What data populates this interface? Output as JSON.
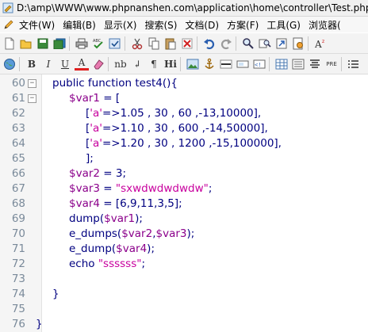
{
  "window": {
    "title": "D:\\amp\\WWW\\www.phpnanshen.com\\application\\home\\controller\\Test.php"
  },
  "menu": {
    "items": [
      {
        "id": "file",
        "label": "文件(W)"
      },
      {
        "id": "edit",
        "label": "编辑(B)"
      },
      {
        "id": "view",
        "label": "显示(X)"
      },
      {
        "id": "search",
        "label": "搜索(S)"
      },
      {
        "id": "document",
        "label": "文档(D)"
      },
      {
        "id": "project",
        "label": "方案(F)"
      },
      {
        "id": "tools",
        "label": "工具(G)"
      },
      {
        "id": "browser",
        "label": "浏览器("
      }
    ]
  },
  "toolbar2_text": {
    "bold": "B",
    "italic": "I",
    "underline": "U",
    "font_color": "A",
    "nbsp": "nb",
    "br": "↲",
    "para": "¶",
    "heading": "Hi",
    "pre": "PRE"
  },
  "colors": {
    "keyword": "#000080",
    "variable": "#8b008b",
    "string": "#c8009e",
    "line_number": "#7a8a9a"
  },
  "editor": {
    "lines": [
      {
        "num": "60",
        "fold": "⊟",
        "indent": 0,
        "tokens": [
          {
            "t": "kw",
            "v": "public function test4(){"
          }
        ]
      },
      {
        "num": "61",
        "fold": "⊟",
        "indent": 1,
        "tokens": [
          {
            "t": "var",
            "v": "$var1"
          },
          {
            "t": "kw",
            "v": " = ["
          }
        ]
      },
      {
        "num": "62",
        "fold": "",
        "indent": 2,
        "tokens": [
          {
            "t": "kw",
            "v": "["
          },
          {
            "t": "str",
            "v": "'a'"
          },
          {
            "t": "kw",
            "v": "=>1.05 , 30 , 60 ,-13,10000],"
          }
        ]
      },
      {
        "num": "63",
        "fold": "",
        "indent": 2,
        "tokens": [
          {
            "t": "kw",
            "v": "["
          },
          {
            "t": "str",
            "v": "'a'"
          },
          {
            "t": "kw",
            "v": "=>1.10 , 30 , 600 ,-14,50000],"
          }
        ]
      },
      {
        "num": "64",
        "fold": "",
        "indent": 2,
        "tokens": [
          {
            "t": "kw",
            "v": "["
          },
          {
            "t": "str",
            "v": "'a'"
          },
          {
            "t": "kw",
            "v": "=>1.20 , 30 , 1200 ,-15,100000],"
          }
        ]
      },
      {
        "num": "65",
        "fold": "",
        "indent": 2,
        "tokens": [
          {
            "t": "kw",
            "v": "];"
          }
        ]
      },
      {
        "num": "66",
        "fold": "",
        "indent": 1,
        "tokens": [
          {
            "t": "var",
            "v": "$var2"
          },
          {
            "t": "kw",
            "v": " = 3;"
          }
        ]
      },
      {
        "num": "67",
        "fold": "",
        "indent": 1,
        "tokens": [
          {
            "t": "var",
            "v": "$var3"
          },
          {
            "t": "kw",
            "v": " = "
          },
          {
            "t": "str",
            "v": "\"sxwdwdwdwdw\""
          },
          {
            "t": "kw",
            "v": ";"
          }
        ]
      },
      {
        "num": "68",
        "fold": "",
        "indent": 1,
        "tokens": [
          {
            "t": "var",
            "v": "$var4"
          },
          {
            "t": "kw",
            "v": " = [6,9,11,3,5];"
          }
        ]
      },
      {
        "num": "69",
        "fold": "",
        "indent": 1,
        "tokens": [
          {
            "t": "kw",
            "v": "dump("
          },
          {
            "t": "var",
            "v": "$var1"
          },
          {
            "t": "kw",
            "v": ");"
          }
        ]
      },
      {
        "num": "70",
        "fold": "",
        "indent": 1,
        "tokens": [
          {
            "t": "kw",
            "v": "e_dumps("
          },
          {
            "t": "var",
            "v": "$var2"
          },
          {
            "t": "kw",
            "v": ","
          },
          {
            "t": "var",
            "v": "$var3"
          },
          {
            "t": "kw",
            "v": ");"
          }
        ]
      },
      {
        "num": "71",
        "fold": "",
        "indent": 1,
        "tokens": [
          {
            "t": "kw",
            "v": "e_dump("
          },
          {
            "t": "var",
            "v": "$var4"
          },
          {
            "t": "kw",
            "v": ");"
          }
        ]
      },
      {
        "num": "72",
        "fold": "",
        "indent": 1,
        "tokens": [
          {
            "t": "kw",
            "v": "echo "
          },
          {
            "t": "str",
            "v": "\"ssssss\""
          },
          {
            "t": "kw",
            "v": ";"
          }
        ]
      },
      {
        "num": "73",
        "fold": "",
        "indent": 0,
        "tokens": []
      },
      {
        "num": "74",
        "fold": "",
        "indent": 0,
        "tokens": [
          {
            "t": "kw",
            "v": "}"
          }
        ]
      },
      {
        "num": "75",
        "fold": "",
        "indent": 0,
        "tokens": []
      },
      {
        "num": "76",
        "fold": "",
        "indent": -1,
        "tokens": [
          {
            "t": "kw",
            "v": "}"
          }
        ]
      }
    ]
  }
}
